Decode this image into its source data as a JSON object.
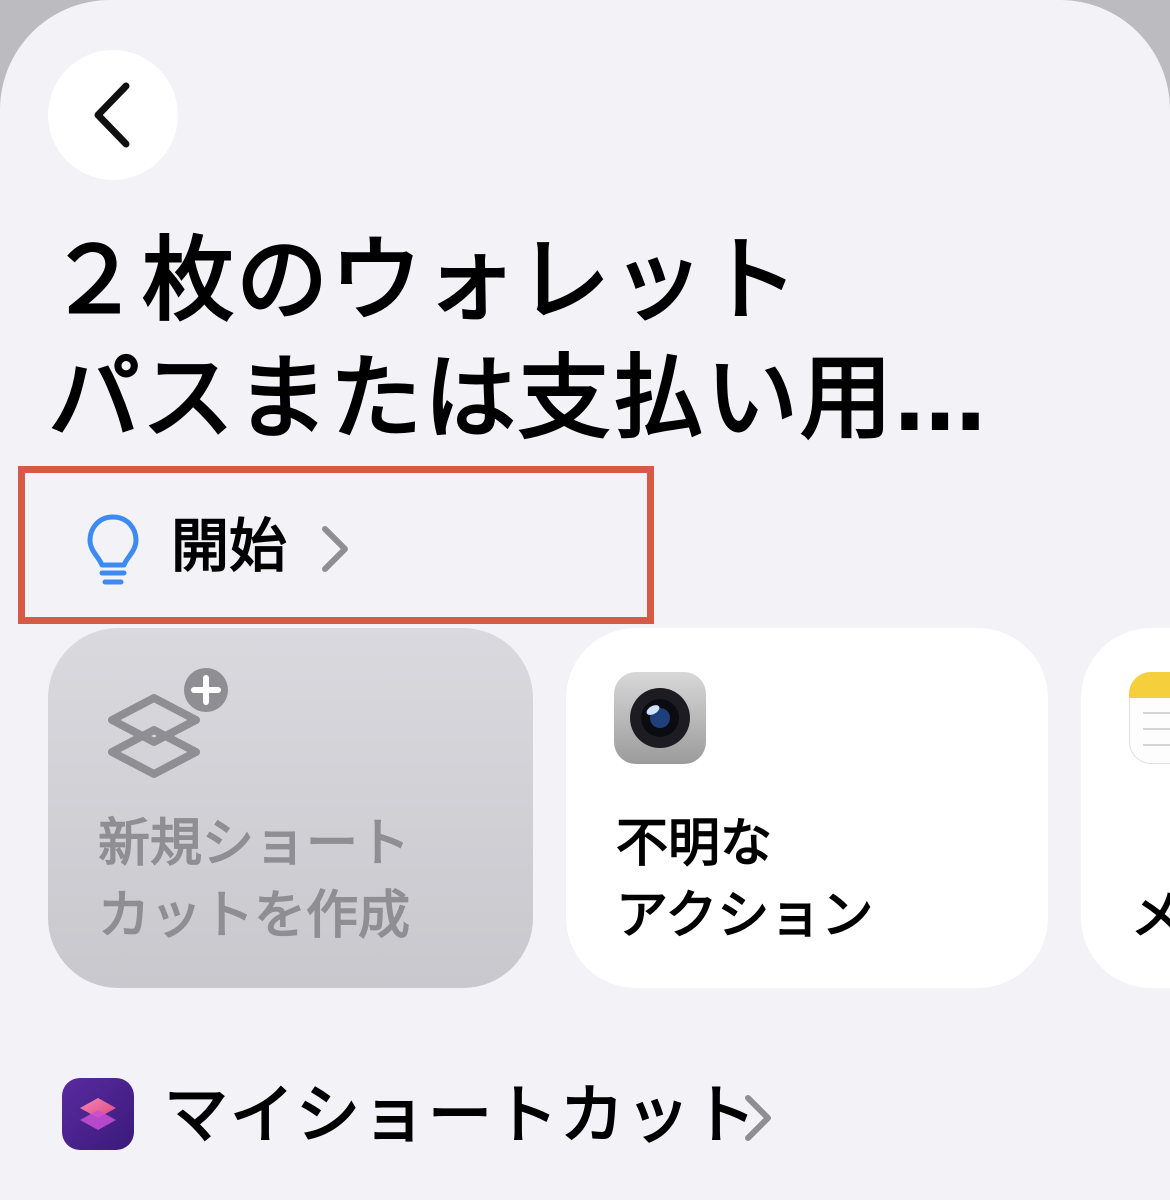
{
  "header": {
    "back_icon": "chevron-left-icon"
  },
  "title": {
    "line1": "２枚のウォレット",
    "line2": "パスまたは支払い用…"
  },
  "start": {
    "icon": "lightbulb-icon",
    "label": "開始",
    "icon_color": "#3d8bf2",
    "highlight_color": "#d65a46"
  },
  "cards": {
    "new_shortcut": {
      "icon": "shortcut-add-icon",
      "line1": "新規ショート",
      "line2": "カットを作成"
    },
    "unknown_action": {
      "icon": "camera-app-icon",
      "line1": "不明な",
      "line2": "アクション"
    },
    "notes": {
      "icon": "notes-app-icon",
      "line1": "メ"
    }
  },
  "my_shortcuts": {
    "icon": "shortcuts-app-icon",
    "label": "マイショートカット"
  }
}
